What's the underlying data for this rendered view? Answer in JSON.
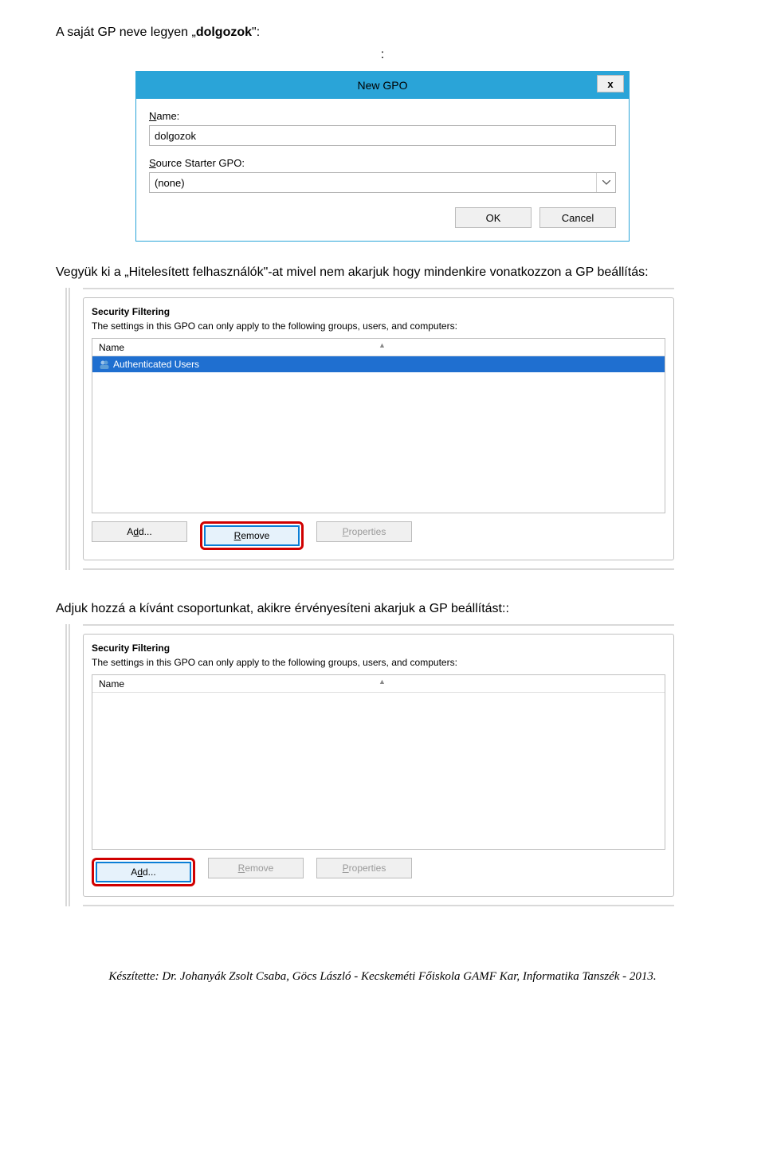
{
  "text": {
    "line1_pre": "A saját GP neve legyen „",
    "line1_bold": "dolgozok",
    "line1_post": "\":",
    "line2_colon": ":",
    "para2": "Vegyük ki a „Hitelesített felhasználók\"-at mivel nem akarjuk hogy mindenkire vonatkozzon a GP beállítás:",
    "para3": "Adjuk hozzá a kívánt csoportunkat, akikre érvényesíteni akarjuk a GP beállítást::",
    "footer": "Készítette: Dr. Johanyák Zsolt Csaba, Göcs László - Kecskeméti Főiskola GAMF Kar, Informatika Tanszék - 2013."
  },
  "dialog": {
    "title": "New GPO",
    "close": "x",
    "name_label_pre": "N",
    "name_label_post": "ame:",
    "name_value": "dolgozok",
    "starter_label_pre": "S",
    "starter_label_post": "ource Starter GPO:",
    "starter_value": "(none)",
    "ok": "OK",
    "cancel": "Cancel"
  },
  "sec1": {
    "title": "Security Filtering",
    "note": "The settings in this GPO can only apply to the following groups, users, and computers:",
    "col": "Name",
    "row": "Authenticated Users",
    "add_pre": "A",
    "add_u": "d",
    "add_post": "d...",
    "rem_u": "R",
    "rem_post": "emove",
    "prop_u": "P",
    "prop_post": "roperties"
  },
  "sec2": {
    "title": "Security Filtering",
    "note": "The settings in this GPO can only apply to the following groups, users, and computers:",
    "col": "Name",
    "add_pre": "A",
    "add_u": "d",
    "add_post": "d...",
    "rem_u": "R",
    "rem_post": "emove",
    "prop_u": "P",
    "prop_post": "roperties"
  }
}
